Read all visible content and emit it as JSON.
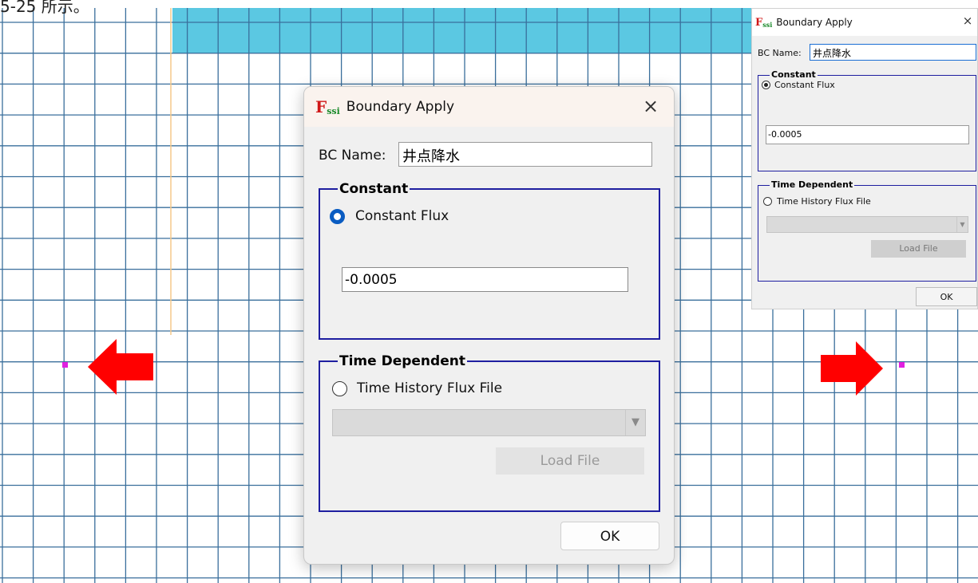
{
  "page_caption": "5-25 所示。",
  "dialogs": {
    "large": {
      "logo": {
        "f": "F",
        "ssi": "ssi"
      },
      "title": "Boundary Apply",
      "close_glyph": "×",
      "bc_name_label": "BC Name:",
      "bc_name_value": "井点降水",
      "constant_group_title": "Constant",
      "constant_flux_label": "Constant Flux",
      "constant_flux_selected": true,
      "constant_flux_value": "-0.0005",
      "time_group_title": "Time Dependent",
      "time_history_label": "Time History Flux File",
      "time_history_selected": false,
      "load_file_label": "Load File",
      "ok_label": "OK"
    },
    "small": {
      "logo": {
        "f": "F",
        "ssi": "ssi"
      },
      "title": "Boundary Apply",
      "close_glyph": "×",
      "bc_name_label": "BC Name:",
      "bc_name_value": "井点降水",
      "constant_group_title": "Constant",
      "constant_flux_label": "Constant Flux",
      "constant_flux_selected": true,
      "constant_flux_value": "-0.0005",
      "time_group_title": "Time Dependent",
      "time_history_label": "Time History Flux File",
      "time_history_selected": false,
      "load_file_label": "Load File",
      "ok_label": "OK"
    }
  },
  "colors": {
    "grid_line": "#3a6f9c",
    "cell_fill": "#5bc8e2",
    "group_border": "#1e1ea0",
    "radio_selected": "#0a5cc2",
    "arrow": "#ff0000",
    "node_marker": "#e020e0",
    "orange_line": "#f5c98a"
  },
  "icons": {
    "close": "close-icon",
    "arrow_left": "arrow-left-icon",
    "arrow_right": "arrow-right-icon",
    "dropdown": "chevron-down-icon"
  }
}
